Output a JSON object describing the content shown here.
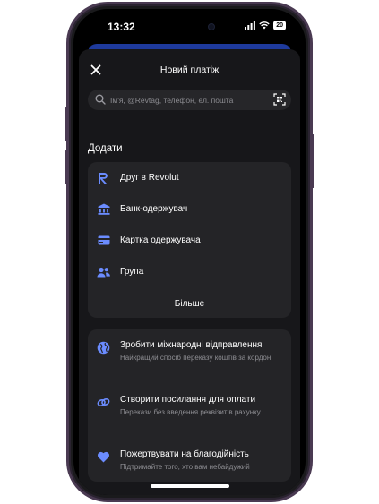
{
  "status_bar": {
    "time": "13:32",
    "battery": "20"
  },
  "header": {
    "title": "Новий платіж"
  },
  "search": {
    "placeholder": "Ім'я, @Revtag, телефон, ел. пошта"
  },
  "add_section": {
    "title": "Додати",
    "items": [
      {
        "label": "Друг в Revolut",
        "icon": "revolut-r-icon"
      },
      {
        "label": "Банк-одержувач",
        "icon": "bank-icon"
      },
      {
        "label": "Картка одержувача",
        "icon": "card-icon"
      },
      {
        "label": "Група",
        "icon": "group-icon"
      }
    ],
    "more_label": "Більше"
  },
  "options": [
    {
      "title": "Зробити міжнародні відправлення",
      "subtitle": "Найкращий спосіб переказу коштів за кордон",
      "icon": "globe-icon"
    },
    {
      "title": "Створити посилання для оплати",
      "subtitle": "Перекази без введення реквізитів рахунку",
      "icon": "link-icon"
    },
    {
      "title": "Пожертвувати на благодійність",
      "subtitle": "Підтримайте того, хто вам небайдужий",
      "icon": "heart-icon"
    }
  ],
  "colors": {
    "accent": "#6b8cff",
    "sheet_bg": "#17171a",
    "card_bg": "#242427",
    "text_secondary": "#8e8e93"
  }
}
